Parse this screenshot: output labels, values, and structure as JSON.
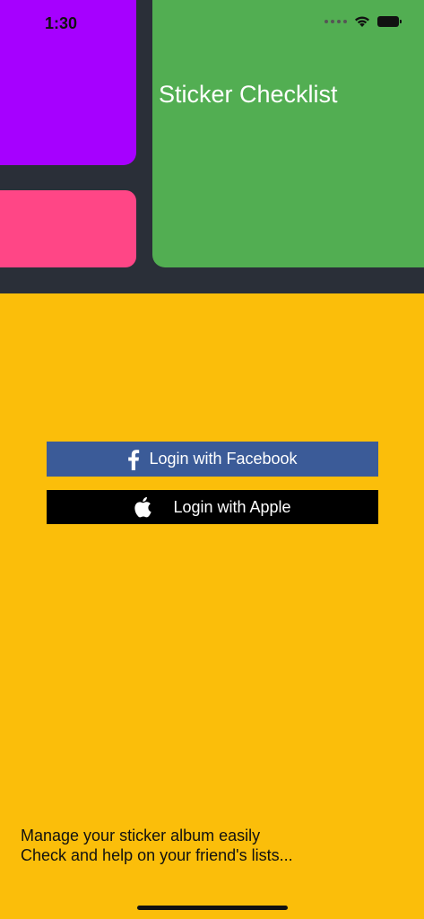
{
  "status_bar": {
    "time": "1:30",
    "icons": [
      "signal-icon",
      "wifi-icon",
      "battery-icon"
    ]
  },
  "header": {
    "app_title": "Sticker Checklist",
    "colors": {
      "background": "#2A2F38",
      "purple": "#A600FF",
      "pink": "#FF4686",
      "green": "#52AE52"
    }
  },
  "login": {
    "facebook_label": "Login with Facebook",
    "facebook_icon": "facebook-icon",
    "facebook_color": "#3B5B98",
    "apple_label": "Login with Apple",
    "apple_icon": "apple-icon",
    "apple_color": "#000000"
  },
  "tagline": {
    "line1": "Manage your sticker album easily",
    "line2": "Check and help on your friend's lists..."
  },
  "theme": {
    "background": "#FBBE0A"
  }
}
